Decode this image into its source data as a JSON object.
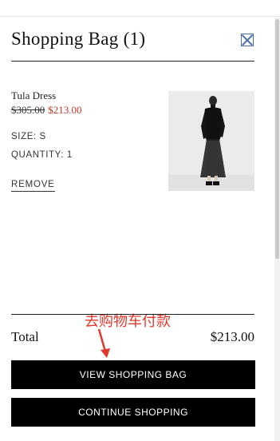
{
  "header": {
    "title": "Shopping Bag (1)"
  },
  "item": {
    "name": "Tula Dress",
    "original_price": "$305.00",
    "sale_price": "$213.00",
    "size": "SIZE: S",
    "quantity": "QUANTITY: 1",
    "remove_label": "REMOVE"
  },
  "summary": {
    "total_label": "Total",
    "total_value": "$213.00"
  },
  "buttons": {
    "view_bag": "VIEW SHOPPING BAG",
    "continue": "CONTINUE SHOPPING"
  },
  "annotation": {
    "text": "去购物车付款"
  },
  "colors": {
    "sale": "#c0392b",
    "annotation": "#e0392b",
    "button": "#000000",
    "close": "#4a6fa5"
  }
}
